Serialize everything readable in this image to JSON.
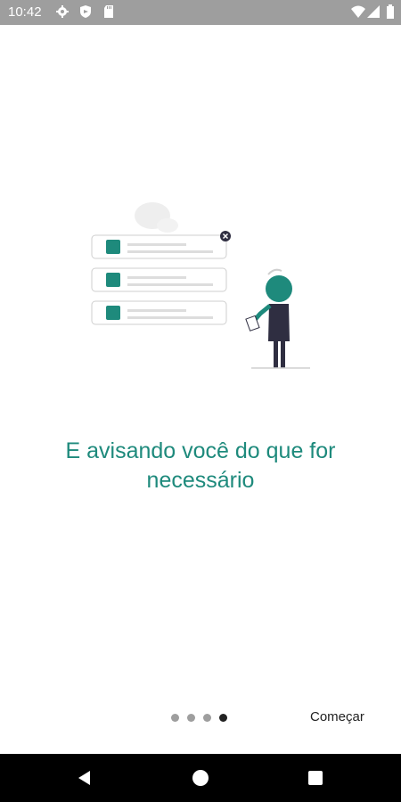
{
  "status_bar": {
    "time": "10:42",
    "left_icons": [
      "gear-icon",
      "shield-icon",
      "sd-card-icon"
    ],
    "right_icons": [
      "wifi-icon",
      "signal-icon",
      "battery-icon"
    ]
  },
  "onboarding": {
    "illustration": "notification-list-illustration",
    "message": "E avisando você do que for necessário",
    "pager": {
      "total": 4,
      "active_index": 3
    },
    "start_label": "Começar"
  },
  "colors": {
    "accent": "#1e8a7c",
    "status_bar": "#9e9e9e",
    "nav_bar": "#000000",
    "dot_inactive": "#9e9e9e",
    "dot_active": "#222222"
  },
  "nav_bar": {
    "icons": [
      "back-icon",
      "home-icon",
      "recents-icon"
    ]
  }
}
